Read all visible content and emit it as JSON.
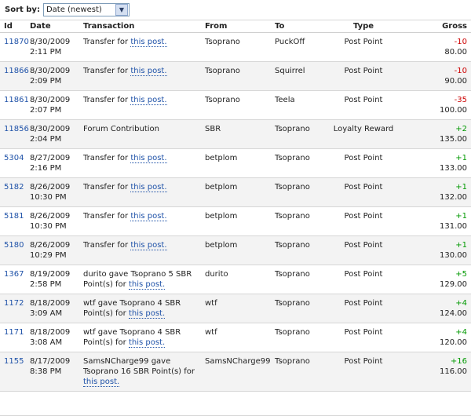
{
  "sort": {
    "label": "Sort by:",
    "selected": "Date (newest)"
  },
  "columns": [
    "Id",
    "Date",
    "Transaction",
    "From",
    "To",
    "Type",
    "Gross"
  ],
  "rows": [
    {
      "id": "11870",
      "date": "8/30/2009",
      "time": "2:11 PM",
      "tx": "Transfer for ",
      "link": "this post.",
      "from": "Tsoprano",
      "to": "PuckOff",
      "type": "Post Point",
      "delta": "-10",
      "total": "80.00",
      "sign": "neg"
    },
    {
      "id": "11866",
      "date": "8/30/2009",
      "time": "2:09 PM",
      "tx": "Transfer for ",
      "link": "this post.",
      "from": "Tsoprano",
      "to": "Squirrel",
      "type": "Post Point",
      "delta": "-10",
      "total": "90.00",
      "sign": "neg"
    },
    {
      "id": "11861",
      "date": "8/30/2009",
      "time": "2:07 PM",
      "tx": "Transfer for ",
      "link": "this post.",
      "from": "Tsoprano",
      "to": "Teela",
      "type": "Post Point",
      "delta": "-35",
      "total": "100.00",
      "sign": "neg"
    },
    {
      "id": "11856",
      "date": "8/30/2009",
      "time": "2:04 PM",
      "tx": "Forum Contribution",
      "link": "",
      "from": "SBR",
      "to": "Tsoprano",
      "type": "Loyalty Reward",
      "delta": "+2",
      "total": "135.00",
      "sign": "pos"
    },
    {
      "id": "5304",
      "date": "8/27/2009",
      "time": "2:16 PM",
      "tx": "Transfer for ",
      "link": "this post.",
      "from": "betplom",
      "to": "Tsoprano",
      "type": "Post Point",
      "delta": "+1",
      "total": "133.00",
      "sign": "pos"
    },
    {
      "id": "5182",
      "date": "8/26/2009",
      "time": "10:30 PM",
      "tx": "Transfer for ",
      "link": "this post.",
      "from": "betplom",
      "to": "Tsoprano",
      "type": "Post Point",
      "delta": "+1",
      "total": "132.00",
      "sign": "pos"
    },
    {
      "id": "5181",
      "date": "8/26/2009",
      "time": "10:30 PM",
      "tx": "Transfer for ",
      "link": "this post.",
      "from": "betplom",
      "to": "Tsoprano",
      "type": "Post Point",
      "delta": "+1",
      "total": "131.00",
      "sign": "pos"
    },
    {
      "id": "5180",
      "date": "8/26/2009",
      "time": "10:29 PM",
      "tx": "Transfer for ",
      "link": "this post.",
      "from": "betplom",
      "to": "Tsoprano",
      "type": "Post Point",
      "delta": "+1",
      "total": "130.00",
      "sign": "pos"
    },
    {
      "id": "1367",
      "date": "8/19/2009",
      "time": "2:58 PM",
      "tx": "durito gave Tsoprano 5 SBR Point(s) for ",
      "link": "this post.",
      "from": "durito",
      "to": "Tsoprano",
      "type": "Post Point",
      "delta": "+5",
      "total": "129.00",
      "sign": "pos"
    },
    {
      "id": "1172",
      "date": "8/18/2009",
      "time": "3:09 AM",
      "tx": "wtf gave Tsoprano 4 SBR Point(s) for ",
      "link": "this post.",
      "from": "wtf",
      "to": "Tsoprano",
      "type": "Post Point",
      "delta": "+4",
      "total": "124.00",
      "sign": "pos"
    },
    {
      "id": "1171",
      "date": "8/18/2009",
      "time": "3:08 AM",
      "tx": "wtf gave Tsoprano 4 SBR Point(s) for ",
      "link": "this post.",
      "from": "wtf",
      "to": "Tsoprano",
      "type": "Post Point",
      "delta": "+4",
      "total": "120.00",
      "sign": "pos"
    },
    {
      "id": "1155",
      "date": "8/17/2009",
      "time": "8:38 PM",
      "tx": "SamsNCharge99 gave Tsoprano 16 SBR Point(s) for ",
      "link": "this post.",
      "from": "SamsNCharge99",
      "to": "Tsoprano",
      "type": "Post Point",
      "delta": "+16",
      "total": "116.00",
      "sign": "pos"
    }
  ]
}
